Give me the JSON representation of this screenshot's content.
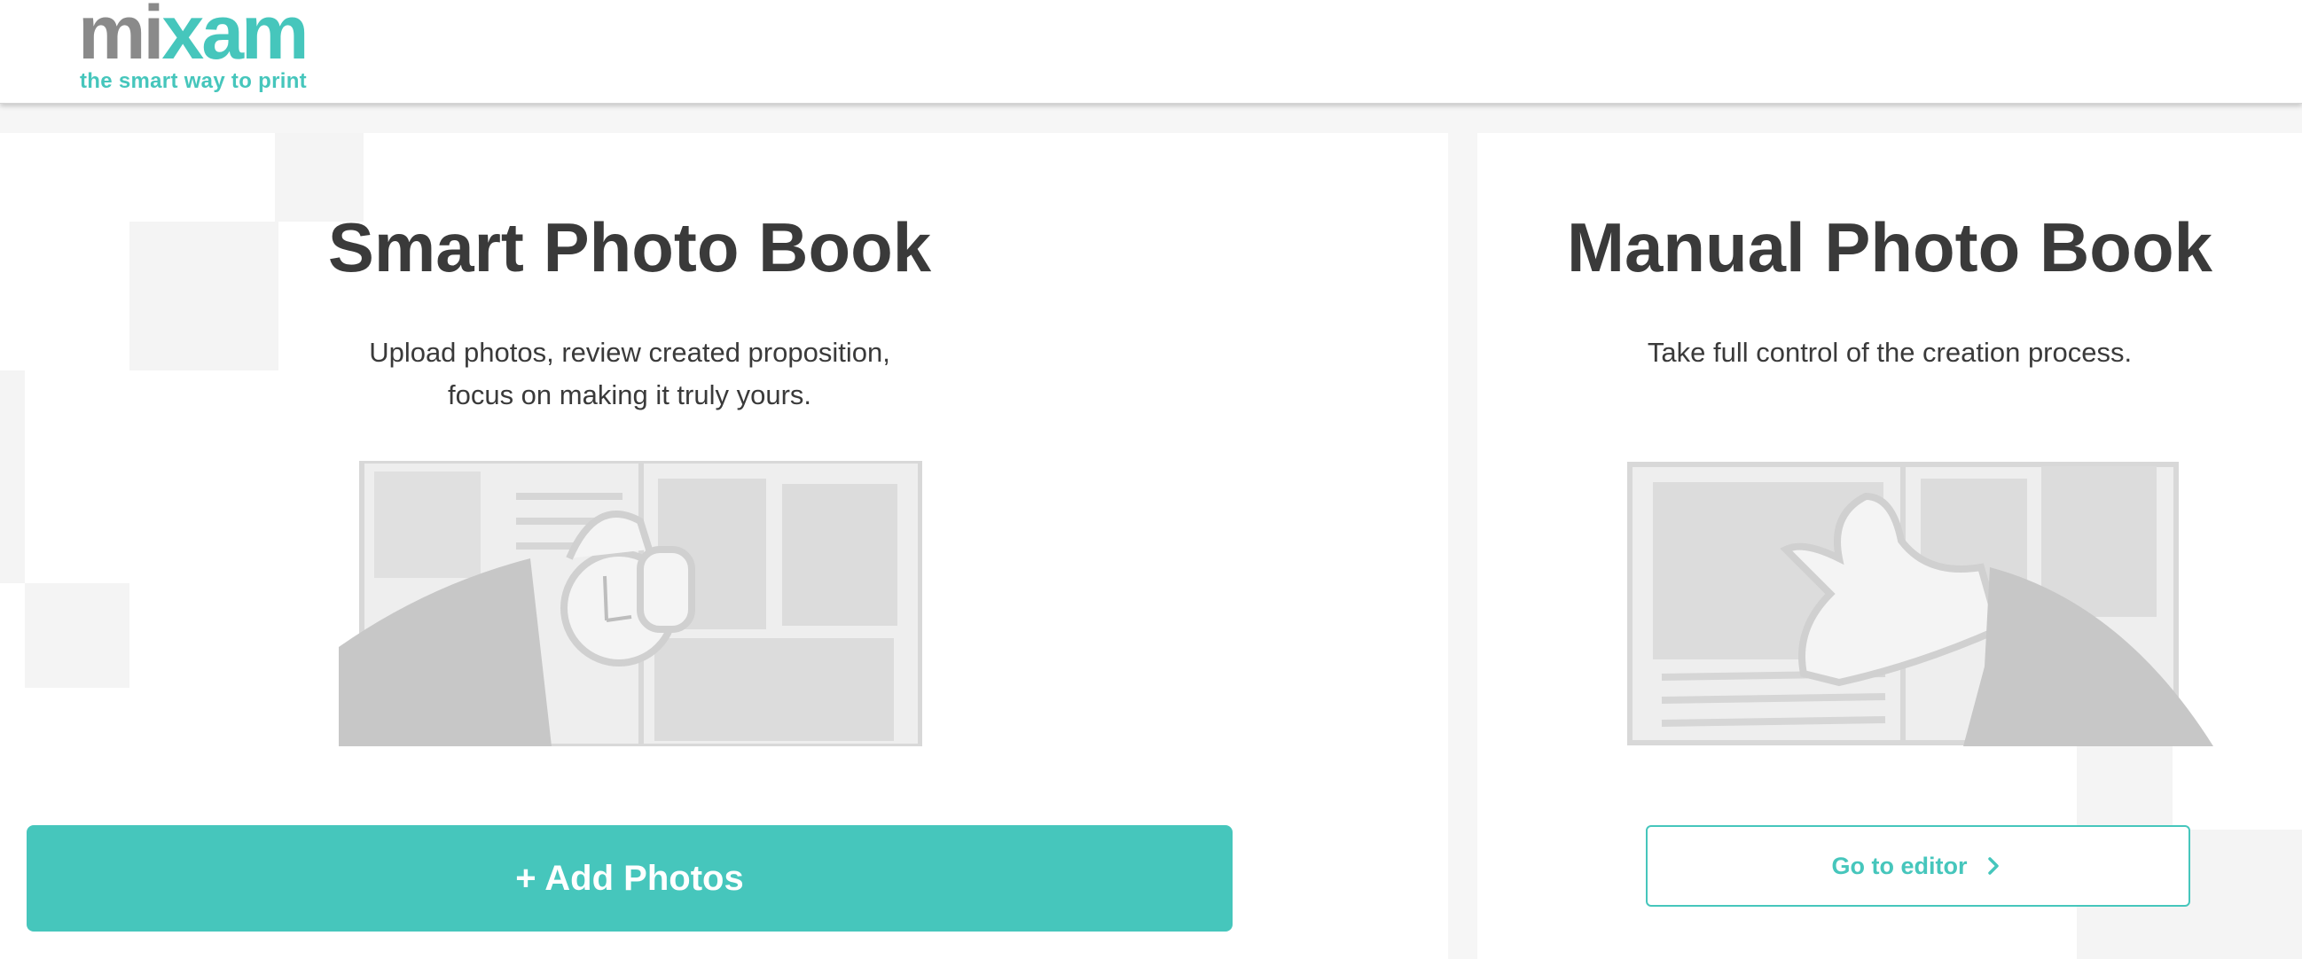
{
  "header": {
    "logo": {
      "part1": "mi",
      "part2": "x",
      "part3": "am",
      "tagline": "the smart way to print"
    }
  },
  "smart": {
    "title": "Smart Photo Book",
    "description_line1": "Upload photos, review created proposition,",
    "description_line2": "focus on making it truly yours.",
    "add_photos_label": "+ Add Photos",
    "illustration": "hand-arranging-photos-illustration"
  },
  "manual": {
    "title": "Manual Photo Book",
    "description": "Take full control of the creation process.",
    "editor_label": "Go to editor",
    "editor_icon": "chevron-right-icon",
    "illustration": "hand-placing-photo-illustration"
  },
  "colors": {
    "accent": "#46c6bc",
    "logo_gray": "#8a8a8a",
    "text": "#3a3a3a",
    "background": "#f6f6f6"
  }
}
